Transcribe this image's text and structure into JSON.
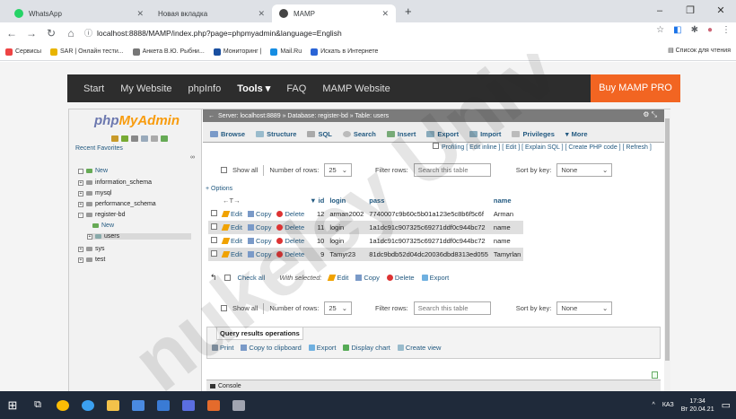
{
  "browser": {
    "tabs": [
      {
        "title": "WhatsApp",
        "color": "#25d366"
      },
      {
        "title": "Новая вкладка",
        "color": "#8ab4f8"
      },
      {
        "title": "MAMP",
        "color": "#444"
      }
    ],
    "new_tab": "+",
    "url": "localhost:8888/MAMP/index.php?page=phpmyadmin&language=English",
    "bookmarks": [
      "Сервисы",
      "SAR | Онлайн тести...",
      "Анкета В.Ю. Рыбни...",
      "Мониторинг |",
      "Mail.Ru",
      "Искать в Интернете"
    ],
    "reading_list": "Список для чтения"
  },
  "mamp": {
    "nav": [
      "Start",
      "My Website",
      "phpInfo",
      "Tools",
      "FAQ",
      "MAMP Website"
    ],
    "active": "Tools",
    "buy": "Buy MAMP PRO"
  },
  "pma": {
    "logo_a": "php",
    "logo_b": "MyAdmin",
    "recent": "Recent",
    "favorites": "Favorites",
    "tree": [
      "New",
      "information_schema",
      "mysql",
      "performance_schema",
      "register-bd",
      "New",
      "users",
      "sys",
      "test"
    ],
    "crumb": "Server: localhost:8889 » Database: register-bd » Table: users",
    "menu": [
      "Browse",
      "Structure",
      "SQL",
      "Search",
      "Insert",
      "Export",
      "Import",
      "Privileges",
      "More"
    ],
    "submenu": "Profiling [ Edit inline ] [ Edit ] [ Explain SQL ] [ Create PHP code ] [ Refresh ]",
    "show_all": "Show all",
    "rows_label": "Number of rows:",
    "rows_val": "25",
    "filter_label": "Filter rows:",
    "filter_ph": "Search this table",
    "sort_label": "Sort by key:",
    "sort_val": "None",
    "options": "+ Options",
    "columns": [
      "id",
      "login",
      "pass",
      "name"
    ],
    "actions": {
      "edit": "Edit",
      "copy": "Copy",
      "delete": "Delete"
    },
    "rows": [
      {
        "id": "12",
        "login": "arman2002",
        "pass": "7740007c9b60c5b01a123e5c8b6f5c6f",
        "name": "Arman"
      },
      {
        "id": "11",
        "login": "login",
        "pass": "1a1dc91c907325c69271ddf0c944bc72",
        "name": "name"
      },
      {
        "id": "10",
        "login": "login",
        "pass": "1a1dc91c907325c69271ddf0c944bc72",
        "name": "name"
      },
      {
        "id": "9",
        "login": "Tamyr23",
        "pass": "81dc9bdb52d04dc20036dbd8313ed055",
        "name": "Tamyrlan"
      }
    ],
    "check_all": "Check all",
    "with_selected": "With selected:",
    "sel_actions": [
      "Edit",
      "Copy",
      "Delete",
      "Export"
    ],
    "qro_title": "Query results operations",
    "qro_links": [
      "Print",
      "Copy to clipboard",
      "Export",
      "Display chart",
      "Create view"
    ],
    "console": "Console"
  },
  "taskbar": {
    "lang": "КАЗ",
    "time": "17:34",
    "date": "Вт 20.04.21"
  }
}
